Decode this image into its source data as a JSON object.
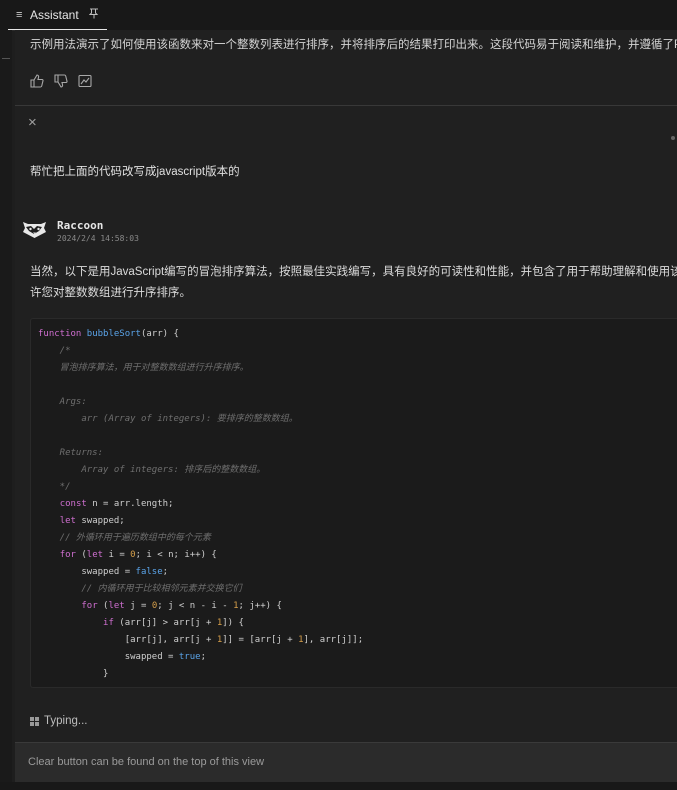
{
  "tab": {
    "title": "Assistant",
    "menu_icon": "≡",
    "pin_icon": "⚲"
  },
  "previous_message": {
    "text": "示例用法演示了如何使用该函数来对一个整数列表进行排序，并将排序后的结果打印出来。这段代码易于阅读和维护，并遵循了Python"
  },
  "feedback": {
    "thumbs_up_icon": "thumbs-up-icon",
    "thumbs_down_icon": "thumbs-down-icon",
    "insert_icon": "insert-icon"
  },
  "close_icon": "×",
  "user_message": "帮忙把上面的代码改写成javascript版本的",
  "assistant": {
    "name": "Raccoon",
    "timestamp": "2024/2/4 14:58:03",
    "reply_lines": [
      "当然，以下是用JavaScript编写的冒泡排序算法，按照最佳实践编写，具有良好的可读性和性能，并包含了用于帮助理解和使用该代码",
      "许您对整数数组进行升序排序。"
    ]
  },
  "code": {
    "language": "javascript",
    "lines": [
      "function bubbleSort(arr) {",
      "    /*",
      "    冒泡排序算法，用于对整数数组进行升序排序。",
      "",
      "    Args:",
      "        arr (Array of integers): 要排序的整数数组。",
      "",
      "    Returns:",
      "        Array of integers: 排序后的整数数组。",
      "    */",
      "    const n = arr.length;",
      "    let swapped;",
      "    // 外循环用于遍历数组中的每个元素",
      "    for (let i = 0; i < n; i++) {",
      "        swapped = false;",
      "        // 内循环用于比较相邻元素并交换它们",
      "        for (let j = 0; j < n - i - 1; j++) {",
      "            if (arr[j] > arr[j + 1]) {",
      "                [arr[j], arr[j + 1]] = [arr[j + 1], arr[j]];",
      "                swapped = true;",
      "            }"
    ]
  },
  "status": {
    "typing_label": "Typing..."
  },
  "input": {
    "placeholder": "Clear button can be found on the top of this view"
  },
  "colors": {
    "keyword": "#cf6fd0",
    "function": "#5aa3e8",
    "comment": "#6f6f6f",
    "number": "#d69f4a"
  }
}
